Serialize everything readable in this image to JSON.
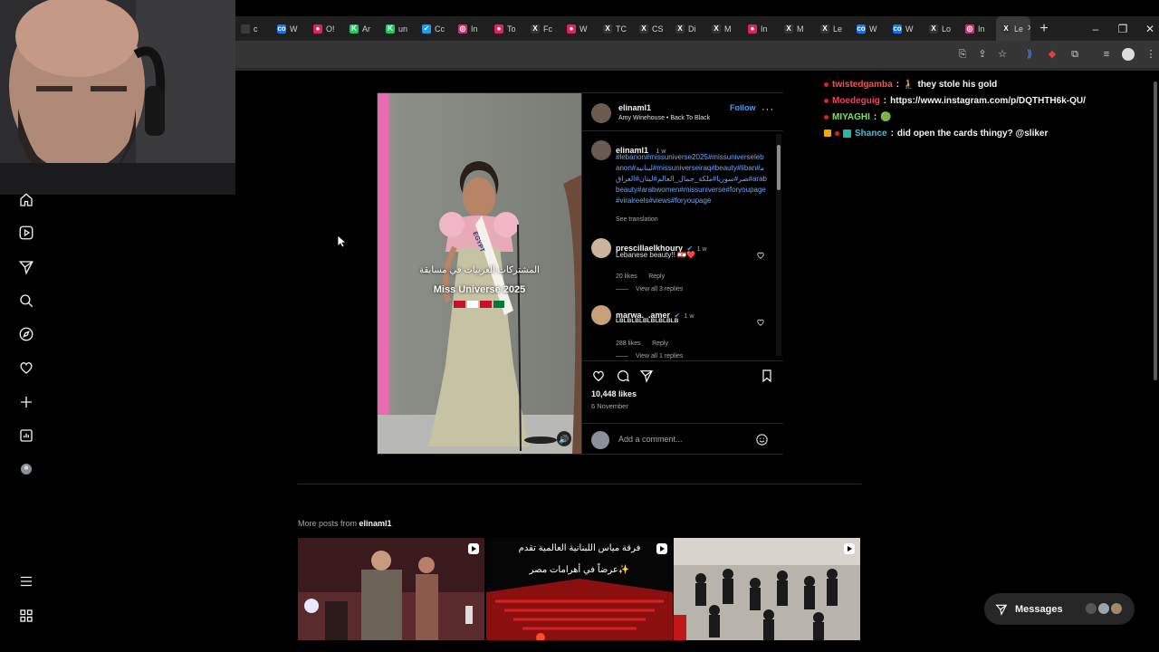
{
  "browser": {
    "tabs": [
      {
        "label": "c",
        "color": "#3a3a3a",
        "glyph": ""
      },
      {
        "label": "W",
        "color": "#1a73e8",
        "glyph": "co"
      },
      {
        "label": "O!",
        "color": "#e0245e",
        "glyph": "●"
      },
      {
        "label": "Ar",
        "color": "#22c55e",
        "glyph": "K"
      },
      {
        "label": "un",
        "color": "#22c55e",
        "glyph": "K"
      },
      {
        "label": "Cc",
        "color": "#1d9bf0",
        "glyph": "✓"
      },
      {
        "label": "In",
        "color": "#d62976",
        "glyph": "◎"
      },
      {
        "label": "To",
        "color": "#e0245e",
        "glyph": "●"
      },
      {
        "label": "Fc",
        "color": "#333",
        "glyph": "X"
      },
      {
        "label": "W",
        "color": "#e0245e",
        "glyph": "●"
      },
      {
        "label": "TC",
        "color": "#333",
        "glyph": "X"
      },
      {
        "label": "CS",
        "color": "#333",
        "glyph": "X"
      },
      {
        "label": "Di",
        "color": "#333",
        "glyph": "X"
      },
      {
        "label": "M",
        "color": "#333",
        "glyph": "X"
      },
      {
        "label": "In",
        "color": "#e0245e",
        "glyph": "●"
      },
      {
        "label": "M",
        "color": "#333",
        "glyph": "X"
      },
      {
        "label": "Le",
        "color": "#333",
        "glyph": "X"
      },
      {
        "label": "W",
        "color": "#1a73e8",
        "glyph": "co"
      },
      {
        "label": "W",
        "color": "#1a73e8",
        "glyph": "co"
      },
      {
        "label": "Lo",
        "color": "#333",
        "glyph": "X"
      },
      {
        "label": "In",
        "color": "#d62976",
        "glyph": "◎"
      },
      {
        "label": "Le",
        "color": "#333",
        "glyph": "X"
      }
    ],
    "new_tab": "+",
    "minimize": "–",
    "restore": "❐",
    "close": "✕"
  },
  "post": {
    "username": "elinaml1",
    "follow": "Follow",
    "audio_artist": "Amy Winehouse",
    "audio_sep": "•",
    "audio_track": "Back To Black",
    "more": "···",
    "caption_time": "1 w",
    "caption": "#lebanon#missuniverse2025#missuniverselebanon#لبنانية#missuniverseiraq#beauty#liban#مصر#سوريا#ملكة_جمال_العالم#لبنان#العراق#arabbeauty#arabwomen#missuniverse#foryoupage#viralreels#views#foryoupage",
    "see_translation": "See translation",
    "video_overlay_ar": "المشتركات العربيات في مسابقة",
    "video_overlay_en": "Miss Universe 2025",
    "sash_text": "EGYPT",
    "likes": "10,448 likes",
    "date": "6 November",
    "add_comment": "Add a comment..."
  },
  "comments": [
    {
      "user": "prescillaelkhoury",
      "verified": true,
      "time": "1 w",
      "text": "Lebanese beauty!! 🇱🇧❤️",
      "likes": "20 likes",
      "reply": "Reply",
      "view_replies": "View all 3 replies"
    },
    {
      "user": "marwa._.amer",
      "verified": true,
      "time": "1 w",
      "text": "LBLBLBLBLBLBLBLB",
      "likes": "288 likes",
      "reply": "Reply",
      "view_replies": "View all 1 replies"
    }
  ],
  "chat": [
    {
      "user": "twistedgamba",
      "user_color": "#ff4d4d",
      "sep": ":",
      "badge": "🧎",
      "message": "they stole his gold"
    },
    {
      "user": "Moedeguig",
      "user_color": "#ff3a5c",
      "sep": ":",
      "badge": "",
      "message": "https://www.instagram.com/p/DQTHTH6k-QU/"
    },
    {
      "user": "MIYAGHI",
      "user_color": "#7ee35b",
      "sep": ":",
      "badge": "",
      "message": "🟢"
    },
    {
      "user": "Shance",
      "user_color": "#39c3e6",
      "sep": ":",
      "badge": "",
      "message": "did open the cards thingy? @sliker"
    }
  ],
  "more_posts": {
    "prefix": "More posts from",
    "user": "elinaml1"
  },
  "thumb2": {
    "line1": "فرقة مياس اللبنانية العالمية تقدم",
    "line2": "عرضاً في أهرامات مصر✨"
  },
  "messages": {
    "label": "Messages"
  },
  "nav_items": [
    "home-icon",
    "reels-icon",
    "send-icon",
    "search-icon",
    "explore-icon",
    "heart-icon",
    "create-icon",
    "dashboard-icon",
    "profile-avatar",
    "menu-icon",
    "apps-icon"
  ]
}
